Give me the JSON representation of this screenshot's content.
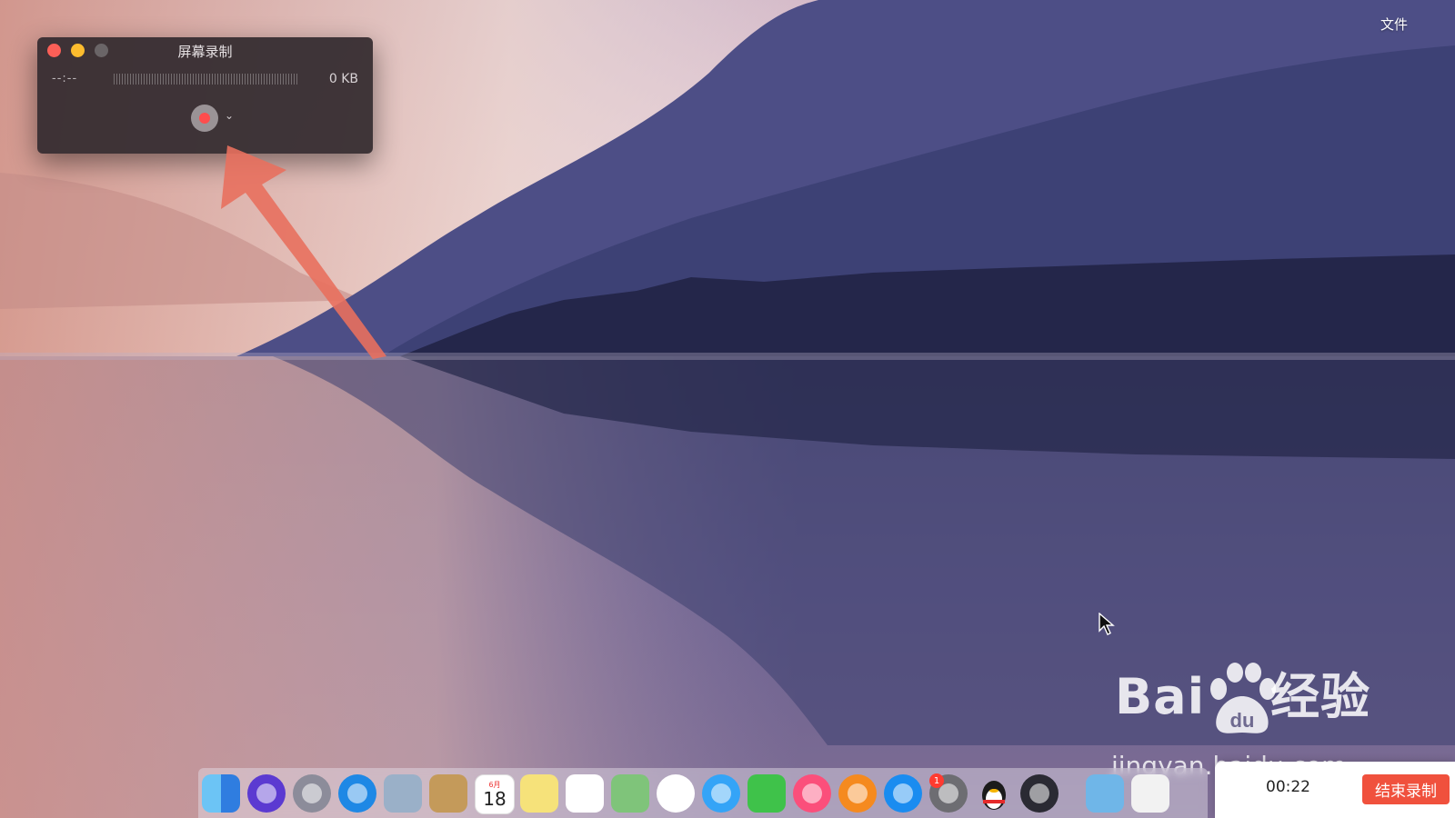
{
  "menubar": {
    "file_menu": "文件"
  },
  "quicktime": {
    "title": "屏幕录制",
    "elapsed": "--:--",
    "file_size": "0 KB"
  },
  "dock": {
    "items": [
      {
        "name": "finder-icon",
        "color": "#3d8ff2"
      },
      {
        "name": "siri-icon",
        "color": "#5b3ad1"
      },
      {
        "name": "launchpad-icon",
        "color": "#8c8c9a"
      },
      {
        "name": "safari-icon",
        "color": "#1e88e5"
      },
      {
        "name": "preview-icon",
        "color": "#9ab0c8"
      },
      {
        "name": "contacts-icon",
        "color": "#c49a5a"
      },
      {
        "name": "calendar-icon",
        "color": "#ffffff",
        "month": "6月",
        "day": "18"
      },
      {
        "name": "notes-icon",
        "color": "#f6e27a"
      },
      {
        "name": "reminders-icon",
        "color": "#ffffff"
      },
      {
        "name": "maps-icon",
        "color": "#7fc47a"
      },
      {
        "name": "photos-icon",
        "color": "#ffffff"
      },
      {
        "name": "messages-icon",
        "color": "#34a4f7"
      },
      {
        "name": "facetime-icon",
        "color": "#3fc24a"
      },
      {
        "name": "itunes-icon",
        "color": "#fb4f7b"
      },
      {
        "name": "ibooks-icon",
        "color": "#f58a1f"
      },
      {
        "name": "app-store-icon",
        "color": "#1a8cf0"
      },
      {
        "name": "system-preferences-icon",
        "color": "#6d6d72"
      },
      {
        "name": "qq-icon",
        "color": "#1b1b1b"
      },
      {
        "name": "quicktime-icon",
        "color": "#2a2a33"
      },
      {
        "name": "downloads-folder-icon",
        "color": "#6fb6e8"
      },
      {
        "name": "document-stack-icon",
        "color": "#f2f2f2"
      }
    ],
    "app_store_badge": "1"
  },
  "recorder_widget": {
    "timer": "00:22",
    "stop_label": "结束录制"
  },
  "watermark": {
    "logo_left": "Bai",
    "logo_right": "经验",
    "url": "jingyan.baidu.com"
  }
}
